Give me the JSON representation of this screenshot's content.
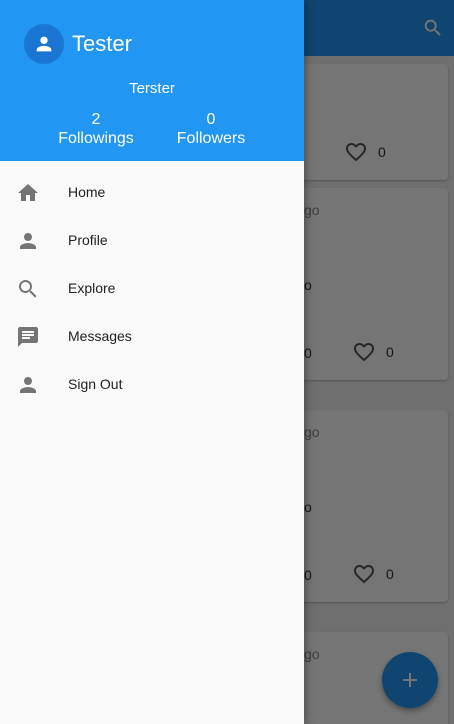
{
  "app": {
    "search_icon": "search-icon",
    "fab_icon": "add-icon",
    "cards": [
      {
        "like_count": "0",
        "fragments": []
      },
      {
        "ago": "go",
        "frag2": "o",
        "frag3": "0",
        "like_count": "0"
      },
      {
        "ago": "go",
        "frag2": "o",
        "frag3": "0",
        "like_count": "0"
      },
      {
        "ago": "go"
      }
    ]
  },
  "drawer": {
    "user": {
      "display_name": "Tester",
      "handle": "Terster",
      "avatar_icon": "person-icon"
    },
    "stats": {
      "followings_count": "2",
      "followings_label": "Followings",
      "followers_count": "0",
      "followers_label": "Followers"
    },
    "menu": [
      {
        "label": "Home",
        "icon": "home-icon"
      },
      {
        "label": "Profile",
        "icon": "person-icon"
      },
      {
        "label": "Explore",
        "icon": "search-icon"
      },
      {
        "label": "Messages",
        "icon": "message-icon"
      },
      {
        "label": "Sign Out",
        "icon": "person-icon"
      }
    ]
  },
  "colors": {
    "primary": "#2196f3",
    "primary_dark": "#1976d2",
    "icon_grey": "#757575"
  }
}
